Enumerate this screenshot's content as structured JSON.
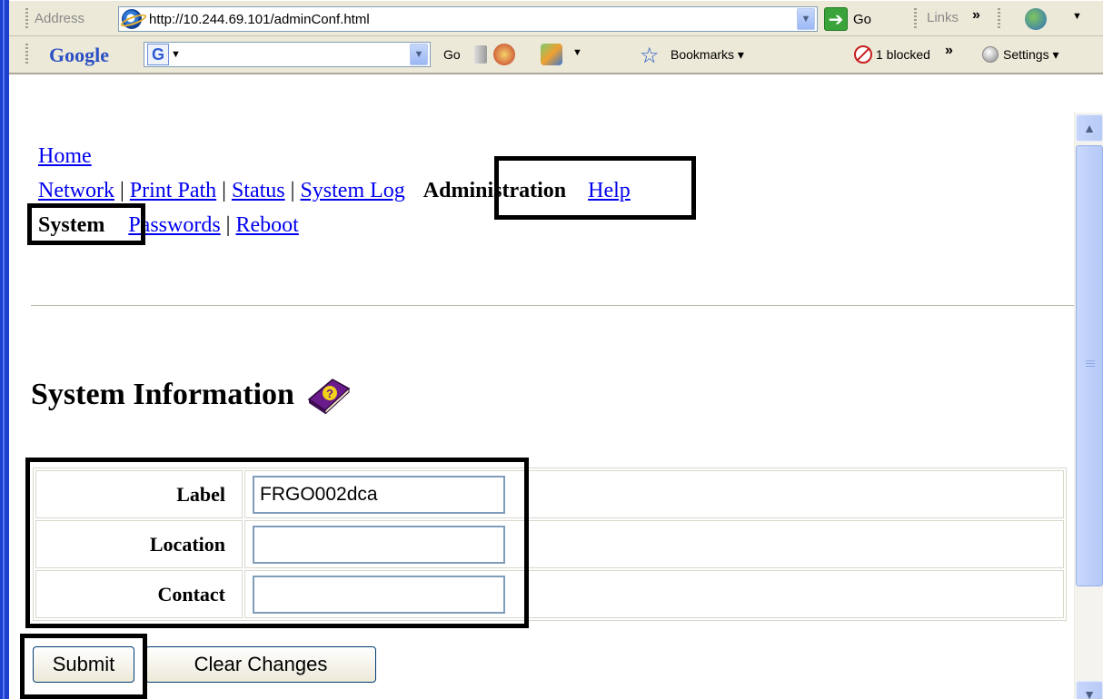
{
  "browser": {
    "address_label": "Address",
    "url": "http://10.244.69.101/adminConf.html",
    "go_label": "Go",
    "links_label": "Links",
    "chevron": "»",
    "google_label": "Google",
    "google_go": "Go",
    "bookmarks_label": "Bookmarks",
    "blocked_label": "1 blocked",
    "settings_label": "Settings"
  },
  "nav": {
    "home": "Home",
    "row2": [
      "Network",
      "Print Path",
      "Status",
      "System Log"
    ],
    "administration": "Administration",
    "help": "Help",
    "system": "System",
    "row3": [
      "Passwords",
      "Reboot"
    ],
    "separator": "|"
  },
  "page": {
    "heading": "System Information"
  },
  "form": {
    "fields": [
      {
        "label": "Label",
        "value": "FRGO002dca"
      },
      {
        "label": "Location",
        "value": ""
      },
      {
        "label": "Contact",
        "value": ""
      }
    ],
    "submit_label": "Submit",
    "clear_label": "Clear Changes"
  }
}
